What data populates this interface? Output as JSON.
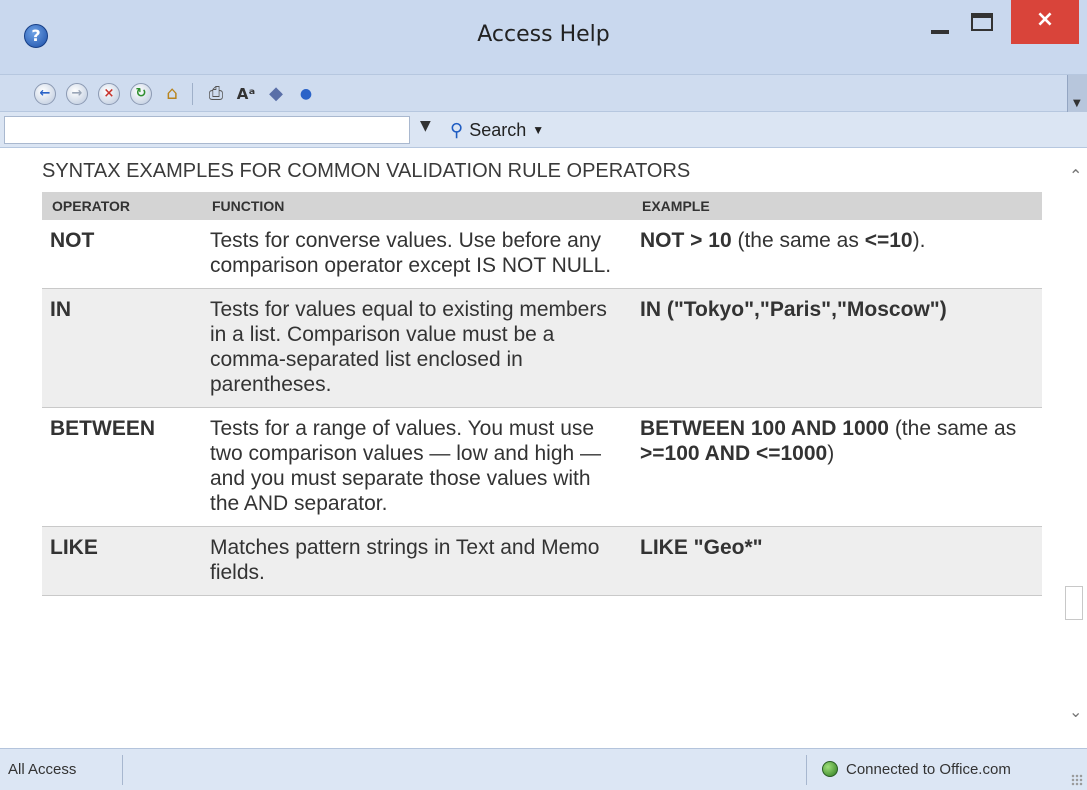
{
  "window": {
    "title": "Access Help",
    "app_icon_glyph": "?",
    "close_glyph": "×"
  },
  "toolbar": {
    "icons": [
      "back-icon",
      "forward-icon",
      "stop-icon",
      "refresh-icon",
      "home-icon",
      "print-icon",
      "text-size-icon",
      "book-icon",
      "pin-icon"
    ]
  },
  "search": {
    "value": "",
    "button_label": "Search"
  },
  "content": {
    "heading": "SYNTAX EXAMPLES FOR COMMON VALIDATION RULE OPERATORS",
    "columns": [
      "OPERATOR",
      "FUNCTION",
      "EXAMPLE"
    ],
    "rows": [
      {
        "operator": "NOT",
        "function": "Tests for converse values. Use before any comparison operator except IS NOT NULL.",
        "example_bold": "NOT > 10",
        "example_rest": " (the same as ",
        "example_bold2": "<=10",
        "example_tail": ")."
      },
      {
        "operator": "IN",
        "function": "Tests for values equal to existing members in a list. Comparison value must be a comma-separated list enclosed in parentheses.",
        "example_bold": "IN (\"Tokyo\",\"Paris\",\"Moscow\")",
        "example_rest": "",
        "example_bold2": "",
        "example_tail": ""
      },
      {
        "operator": "BETWEEN",
        "function": "Tests for a range of values. You must use two comparison values — low and high — and you must separate those values with the AND separator.",
        "example_bold": "BETWEEN 100 AND 1000",
        "example_rest": " (the same as ",
        "example_bold2": ">=100 AND <=1000",
        "example_tail": ")"
      },
      {
        "operator": "LIKE",
        "function": "Matches pattern strings in Text and Memo fields.",
        "example_bold": "LIKE \"Geo*\"",
        "example_rest": "",
        "example_bold2": "",
        "example_tail": ""
      }
    ]
  },
  "status": {
    "left": "All Access",
    "right": "Connected to Office.com"
  }
}
